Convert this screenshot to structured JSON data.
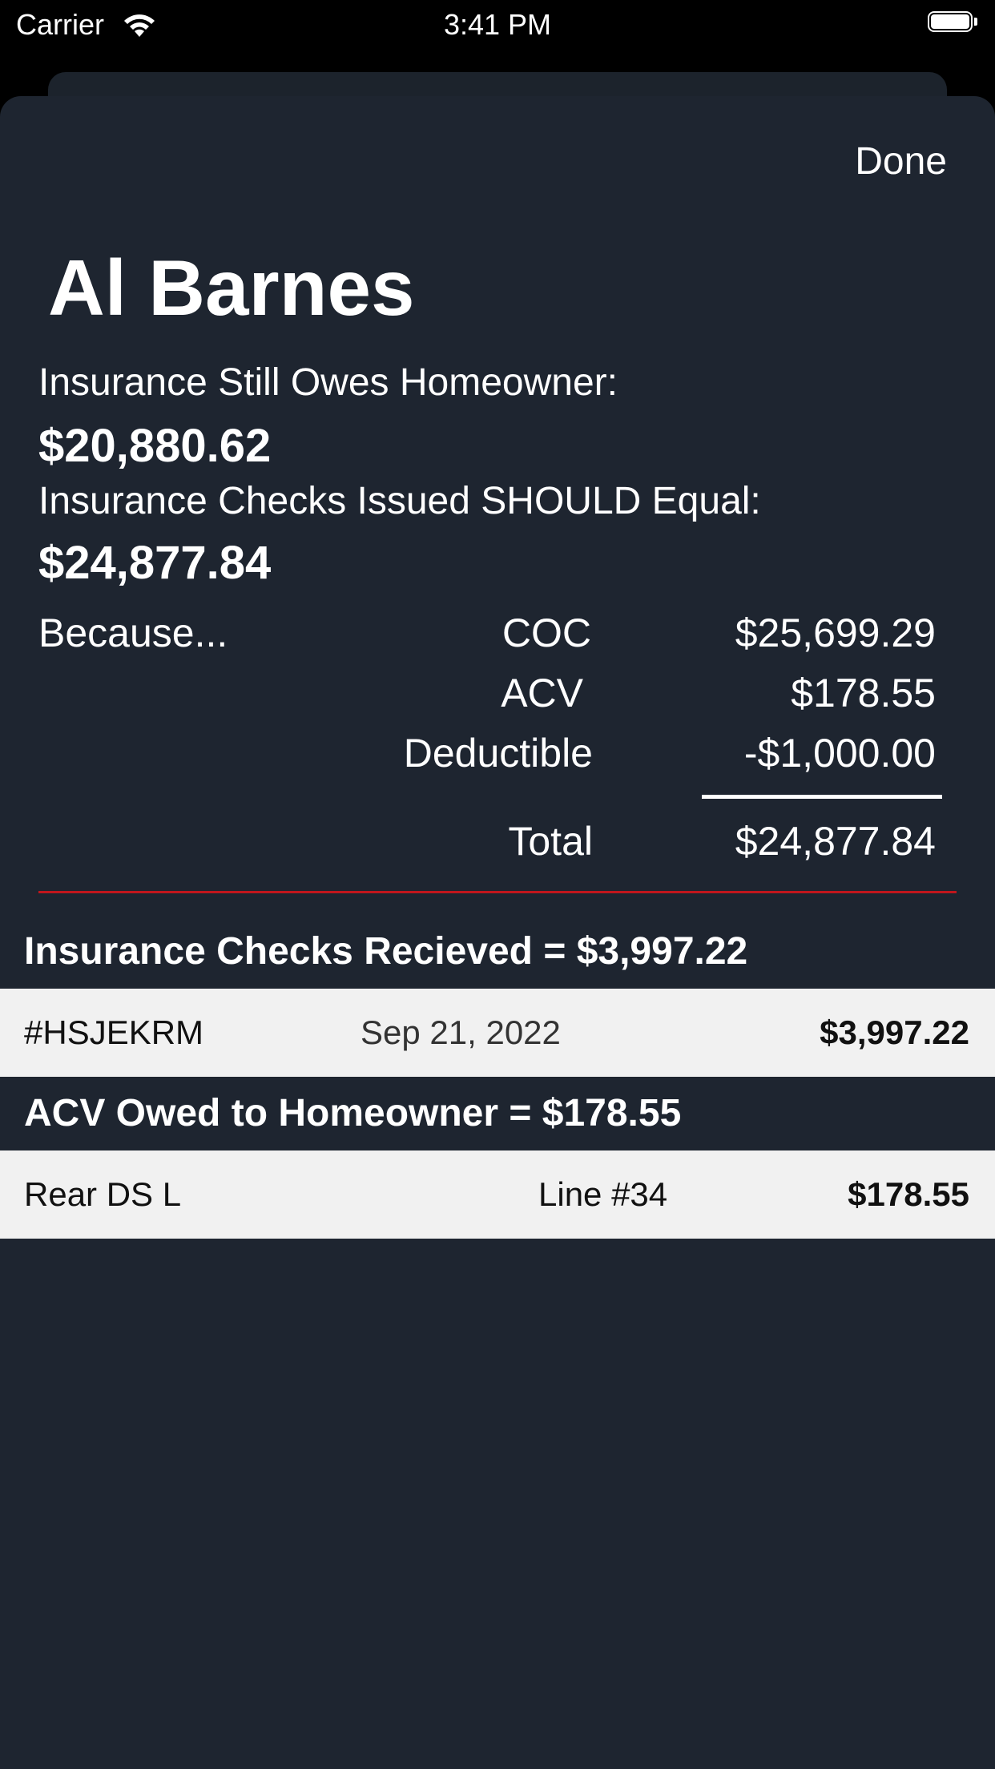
{
  "status_bar": {
    "carrier": "Carrier",
    "time": "3:41 PM",
    "wifi_icon": "wifi-icon",
    "battery_icon": "battery-icon"
  },
  "header": {
    "done_label": "Done",
    "name": "Al Barnes"
  },
  "summary": {
    "still_owes_label": "Insurance Still Owes Homeowner:",
    "still_owes_amount": "$20,880.62",
    "checks_should_label": "Insurance Checks Issued SHOULD Equal:",
    "checks_should_amount": "$24,877.84"
  },
  "calculation": {
    "because_label": "Because...",
    "rows": [
      {
        "label": "COC",
        "value": "$25,699.29"
      },
      {
        "label": "ACV",
        "value": "$178.55"
      },
      {
        "label": "Deductible",
        "value": "-$1,000.00"
      }
    ],
    "total_label": "Total",
    "total_value": "$24,877.84"
  },
  "checks_section": {
    "header": "Insurance Checks Recieved = $3,997.22",
    "items": [
      {
        "id": "#HSJEKRM",
        "date": "Sep 21, 2022",
        "amount": "$3,997.22"
      }
    ]
  },
  "acv_section": {
    "header": "ACV Owed to Homeowner = $178.55",
    "items": [
      {
        "name": "Rear DS L",
        "line": "Line #34",
        "amount": "$178.55"
      }
    ]
  },
  "colors": {
    "background": "#1e2530",
    "divider": "#c0161c",
    "row_background": "#f1f1f1"
  }
}
